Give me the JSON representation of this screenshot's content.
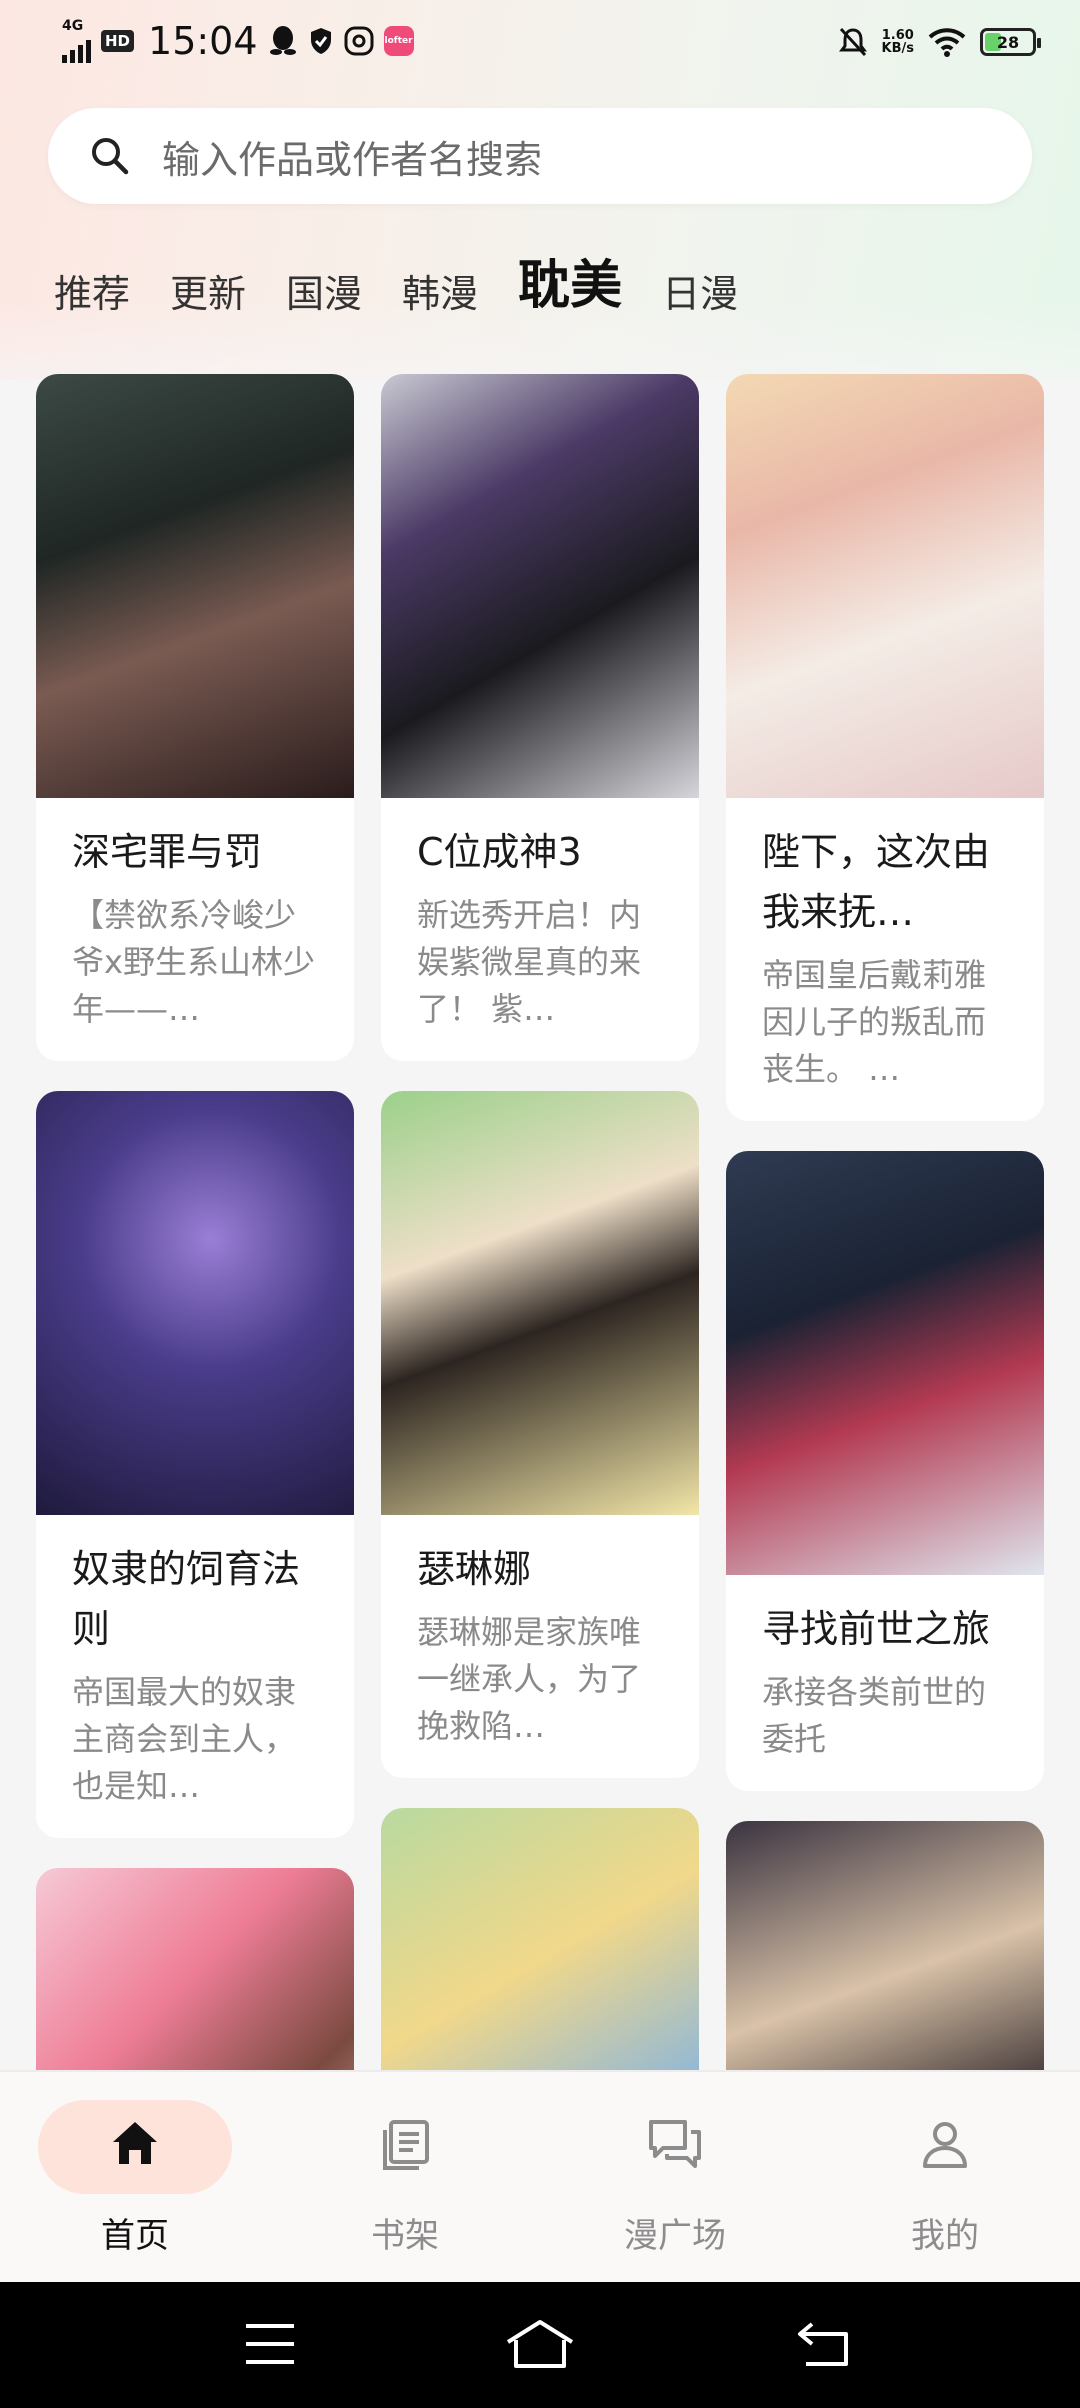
{
  "status_bar": {
    "network": "4G",
    "hd": "HD",
    "time": "15:04",
    "speed_value": "1.60",
    "speed_unit": "KB/s",
    "battery": "28",
    "app_icons": [
      "qq-icon",
      "shield-icon",
      "assistant-icon",
      "lofter-icon"
    ],
    "app_badge_text": "lofter"
  },
  "search": {
    "placeholder": "输入作品或作者名搜索"
  },
  "tabs": [
    {
      "label": "推荐",
      "active": false
    },
    {
      "label": "更新",
      "active": false
    },
    {
      "label": "国漫",
      "active": false
    },
    {
      "label": "韩漫",
      "active": false
    },
    {
      "label": "耽美",
      "active": true
    },
    {
      "label": "日漫",
      "active": false
    }
  ],
  "comics": [
    {
      "title": "深宅罪与罚",
      "desc": "【禁欲系冷峻少爷x野生系山林少年——…"
    },
    {
      "title": "C位成神3",
      "desc": "新选秀开启！内娱紫微星真的来了！ 紫…"
    },
    {
      "title": "陛下，这次由我来抚…",
      "desc": "帝国皇后戴莉雅因儿子的叛乱而丧生。 …"
    },
    {
      "title": "奴隶的饲育法则",
      "desc": "帝国最大的奴隶主商会到主人，也是知…"
    },
    {
      "title": "瑟琳娜",
      "desc": "瑟琳娜是家族唯一继承人，为了挽救陷…"
    },
    {
      "title": "寻找前世之旅",
      "desc": "承接各类前世的委托"
    }
  ],
  "bottom_nav": [
    {
      "label": "首页",
      "icon": "home-icon",
      "active": true
    },
    {
      "label": "书架",
      "icon": "bookshelf-icon",
      "active": false
    },
    {
      "label": "漫广场",
      "icon": "chat-square-icon",
      "active": false
    },
    {
      "label": "我的",
      "icon": "profile-icon",
      "active": false
    }
  ],
  "system_nav": [
    "menu-icon",
    "home-outline-icon",
    "back-icon"
  ],
  "colors": {
    "accent": "#f28a3a",
    "active_pill": "#fde3da",
    "text_primary": "#1a1a1a",
    "text_secondary": "#8a8a8a"
  }
}
